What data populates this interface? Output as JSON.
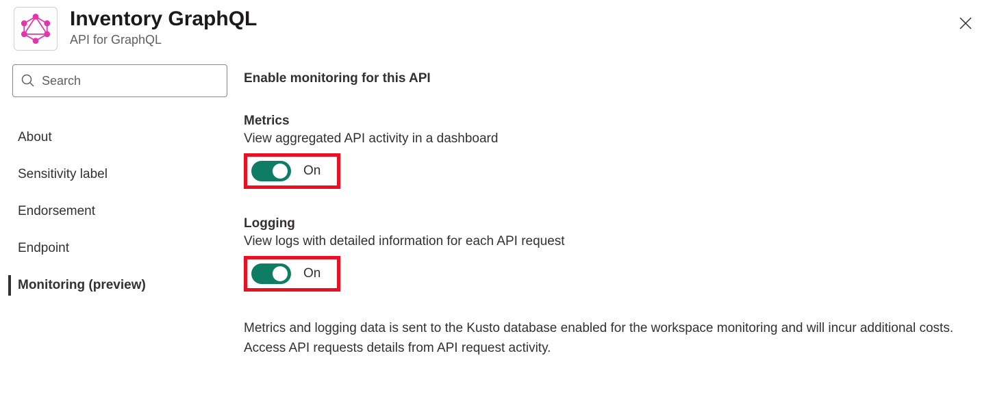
{
  "header": {
    "title": "Inventory GraphQL",
    "subtitle": "API for GraphQL"
  },
  "search": {
    "placeholder": "Search"
  },
  "sidebar": {
    "items": [
      {
        "label": "About",
        "selected": false
      },
      {
        "label": "Sensitivity label",
        "selected": false
      },
      {
        "label": "Endorsement",
        "selected": false
      },
      {
        "label": "Endpoint",
        "selected": false
      },
      {
        "label": "Monitoring (preview)",
        "selected": true
      }
    ]
  },
  "main": {
    "heading": "Enable monitoring for this API",
    "metrics": {
      "title": "Metrics",
      "description": "View aggregated API activity in a dashboard",
      "state_label": "On",
      "enabled": true
    },
    "logging": {
      "title": "Logging",
      "description": "View logs with detailed information for each API request",
      "state_label": "On",
      "enabled": true
    },
    "note": "Metrics and logging data is sent to the Kusto database enabled for the workspace monitoring and will incur additional costs. Access API requests details from API request activity."
  },
  "colors": {
    "toggle_on": "#0e7d63",
    "highlight_border": "#e81123",
    "graphql_pink": "#e535ab"
  }
}
